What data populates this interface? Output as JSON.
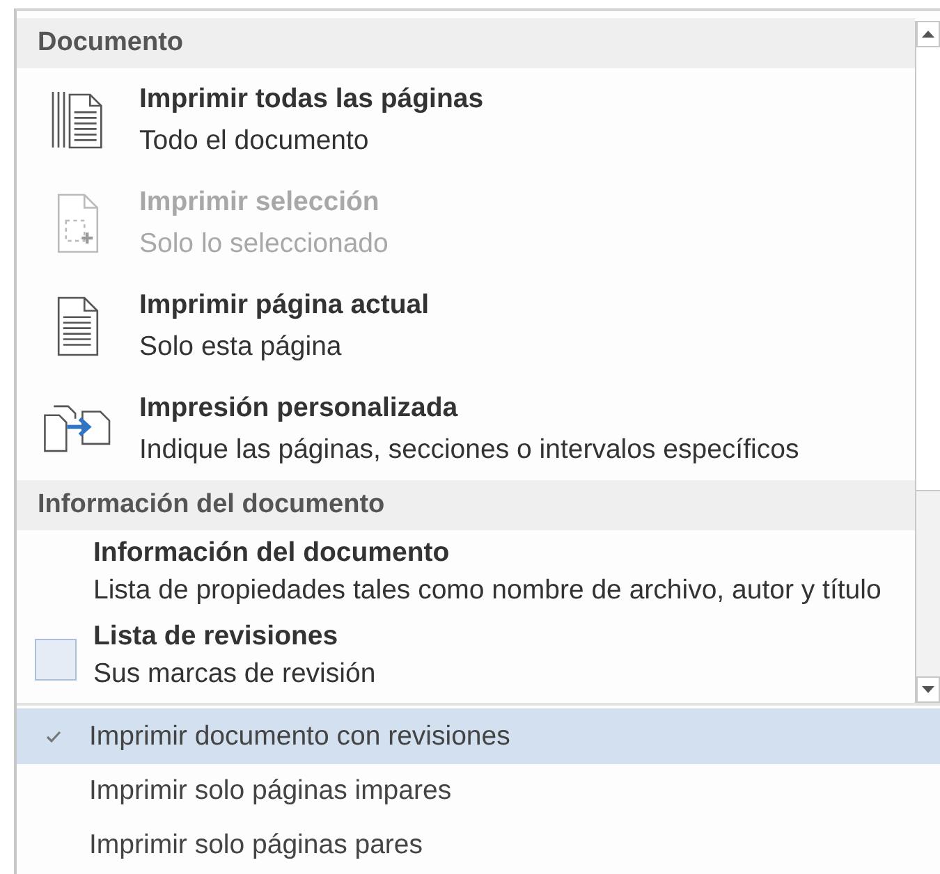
{
  "sections": [
    {
      "header": "Documento",
      "items": [
        {
          "title": "Imprimir todas las páginas",
          "subtitle": "Todo el documento",
          "disabled": false
        },
        {
          "title": "Imprimir selección",
          "subtitle": "Solo lo seleccionado",
          "disabled": true
        },
        {
          "title": "Imprimir página actual",
          "subtitle": "Solo esta página",
          "disabled": false
        },
        {
          "title": "Impresión personalizada",
          "subtitle": "Indique las páginas, secciones o intervalos específicos",
          "disabled": false
        }
      ]
    },
    {
      "header": "Información del documento",
      "items": [
        {
          "title": "Información del documento",
          "subtitle": "Lista de propiedades tales como nombre de archivo, autor y título",
          "disabled": false
        },
        {
          "title": "Lista de revisiones",
          "subtitle": "Sus marcas de revisión",
          "disabled": false
        }
      ]
    }
  ],
  "options": [
    {
      "label": "Imprimir documento con revisiones",
      "selected": true
    },
    {
      "label": "Imprimir solo páginas impares",
      "selected": false
    },
    {
      "label": "Imprimir solo páginas pares",
      "selected": false
    }
  ]
}
